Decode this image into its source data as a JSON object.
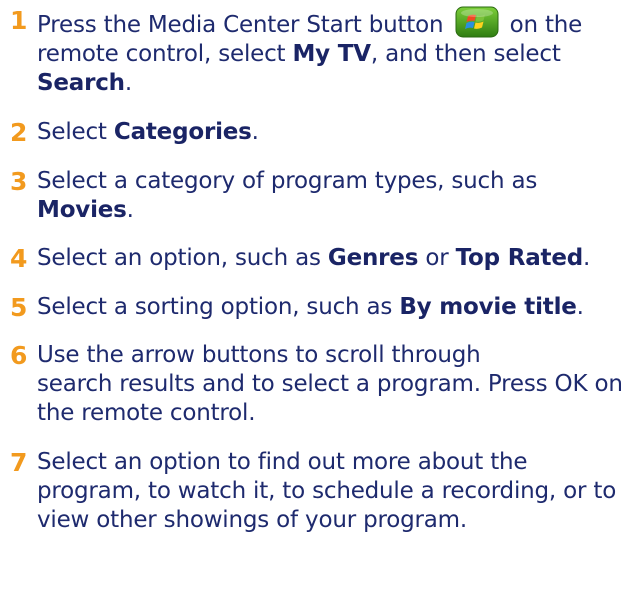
{
  "steps": [
    {
      "number": "1",
      "text_a": "Press the Media Center Start button",
      "icon": "windows-start-button-icon",
      "text_b": "on the remote control, select",
      "bold_a": "My TV",
      "text_c": ", and then select",
      "bold_b": "Search",
      "text_d": "."
    },
    {
      "number": "2",
      "text_a": "Select",
      "bold_a": "Categories",
      "text_b": "."
    },
    {
      "number": "3",
      "text_a": "Select a category of program types, such as",
      "bold_a": "Movies",
      "text_b": "."
    },
    {
      "number": "4",
      "text_a": "Select an option, such as",
      "bold_a": "Genres",
      "text_b": "or",
      "bold_b": "Top Rated",
      "text_c": "."
    },
    {
      "number": "5",
      "text_a": "Select a sorting option, such as",
      "bold_a": "By movie title",
      "text_b": "."
    },
    {
      "number": "6",
      "line_1": "Use the arrow buttons to scroll through",
      "line_2": "search results and to select a program. Press OK on the remote control."
    },
    {
      "number": "7",
      "text": "Select an option to find out more about the program, to watch it, to schedule a recording, or to view other showings of your program."
    }
  ],
  "colors": {
    "step_number": "#f29a1e",
    "body_text": "#1e2a6e",
    "icon_green": "#4a9a1e"
  }
}
